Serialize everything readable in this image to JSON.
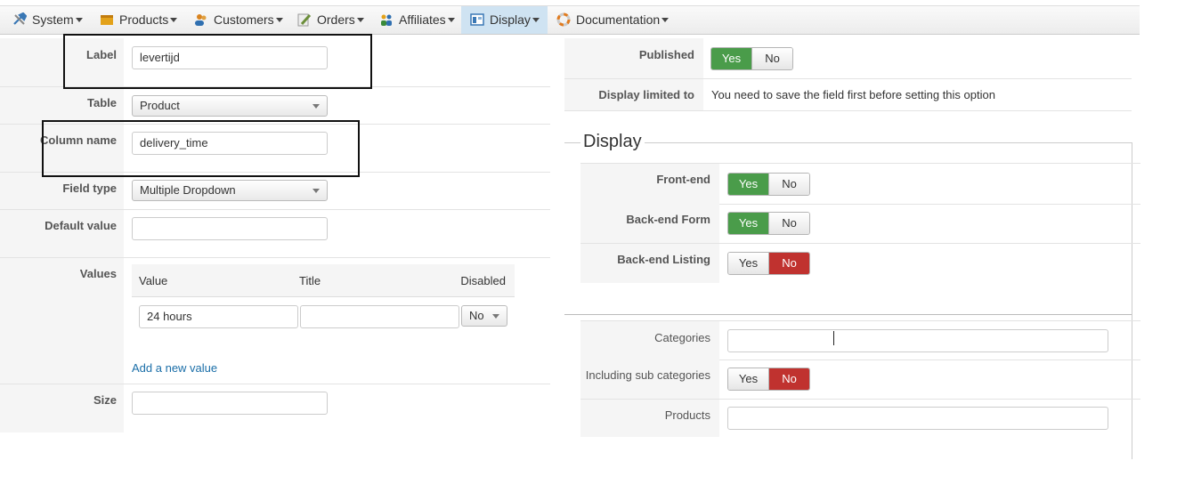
{
  "menu": [
    {
      "label": "System",
      "icon": "tools-icon",
      "color": "#3a78b5"
    },
    {
      "label": "Products",
      "icon": "box-icon",
      "color": "#e3a21a"
    },
    {
      "label": "Customers",
      "icon": "users-icon",
      "color": "#d9831f"
    },
    {
      "label": "Orders",
      "icon": "pencil-icon",
      "color": "#6b8e3a"
    },
    {
      "label": "Affiliates",
      "icon": "people-icon",
      "color": "#2f6fb0"
    },
    {
      "label": "Display",
      "icon": "display-icon",
      "color": "#3a78b5",
      "active": true
    },
    {
      "label": "Documentation",
      "icon": "lifebuoy-icon",
      "color": "#e07b1f"
    }
  ],
  "form": {
    "label": {
      "label": "Label",
      "value": "levertijd"
    },
    "table": {
      "label": "Table",
      "value": "Product"
    },
    "column_name": {
      "label": "Column name",
      "value": "delivery_time"
    },
    "field_type": {
      "label": "Field type",
      "value": "Multiple Dropdown"
    },
    "default_value": {
      "label": "Default value",
      "value": ""
    },
    "values": {
      "label": "Values",
      "headers": [
        "Value",
        "Title",
        "Disabled"
      ],
      "rows": [
        {
          "value": "24 hours",
          "title": "",
          "disabled": "No"
        }
      ],
      "add_link": "Add a new value"
    },
    "size": {
      "label": "Size",
      "value": ""
    }
  },
  "right": {
    "published": {
      "label": "Published",
      "yes": "Yes",
      "no": "No",
      "state": "yes"
    },
    "display_limited_to": {
      "label": "Display limited to",
      "text": "You need to save the field first before setting this option"
    },
    "display_legend": "Display",
    "front_end": {
      "label": "Front-end",
      "yes": "Yes",
      "no": "No",
      "state": "yes"
    },
    "back_end_form": {
      "label": "Back-end Form",
      "yes": "Yes",
      "no": "No",
      "state": "yes"
    },
    "back_end_listing": {
      "label": "Back-end Listing",
      "yes": "Yes",
      "no": "No",
      "state": "no"
    },
    "categories": {
      "label": "Categories",
      "value": ""
    },
    "including_sub_categories": {
      "label": "Including sub categories",
      "yes": "Yes",
      "no": "No",
      "state": "no"
    },
    "products": {
      "label": "Products",
      "value": ""
    }
  },
  "colors": {
    "green": "#4a9c4a",
    "red": "#c0322f",
    "link": "#1a6ea8",
    "active_menu": "#cfe3f2"
  }
}
